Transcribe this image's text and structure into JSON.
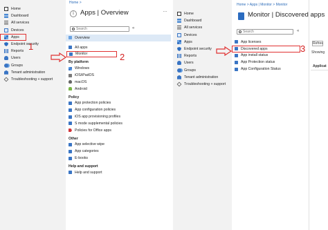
{
  "left_nav": {
    "items": [
      {
        "label": "Home",
        "icon": "home-icon"
      },
      {
        "label": "Dashboard",
        "icon": "dashboard-icon"
      },
      {
        "label": "All services",
        "icon": "all-services-icon"
      },
      {
        "label": "Devices",
        "icon": "devices-icon"
      },
      {
        "label": "Apps",
        "icon": "apps-icon"
      },
      {
        "label": "Endpoint security",
        "icon": "endpoint-security-icon"
      },
      {
        "label": "Reports",
        "icon": "reports-icon"
      },
      {
        "label": "Users",
        "icon": "users-icon"
      },
      {
        "label": "Groups",
        "icon": "groups-icon"
      },
      {
        "label": "Tenant administration",
        "icon": "tenant-admin-icon"
      },
      {
        "label": "Troubleshooting + support",
        "icon": "troubleshooting-icon"
      }
    ]
  },
  "apps_blade": {
    "breadcrumb": "Home >",
    "title": "Apps | Overview",
    "search_placeholder": "Search",
    "collapse": "«",
    "items": [
      {
        "label": "Overview"
      },
      {
        "label": "All apps"
      },
      {
        "label": "Monitor"
      }
    ],
    "sections": [
      {
        "heading": "By platform",
        "items": [
          "Windows",
          "iOS/iPadOS",
          "macOS",
          "Android"
        ]
      },
      {
        "heading": "Policy",
        "items": [
          "App protection policies",
          "App configuration policies",
          "iOS app provisioning profiles",
          "S mode supplemental policies",
          "Policies for Office apps"
        ]
      },
      {
        "heading": "Other",
        "items": [
          "App selective wipe",
          "App categories",
          "E-books"
        ]
      },
      {
        "heading": "Help and support",
        "items": [
          "Help and support"
        ]
      }
    ]
  },
  "monitor_blade": {
    "breadcrumb": "Home > Apps | Monitor > Monitor",
    "title": "Monitor | Discovered apps",
    "search_placeholder": "Search",
    "collapse": "«",
    "items": [
      "App licenses",
      "Discovered apps",
      "App install status",
      "App Protection status",
      "App Configuration Status"
    ],
    "right_partial": {
      "refresh": "Refres",
      "showing": "Showing",
      "column": "Applicat"
    }
  },
  "annotations": {
    "step1": "1",
    "step2": "2",
    "step3": "3"
  },
  "colors": {
    "annotation_red": "#e03030",
    "accent_blue": "#2b6cc0",
    "selected_bg": "#dde9f6"
  }
}
